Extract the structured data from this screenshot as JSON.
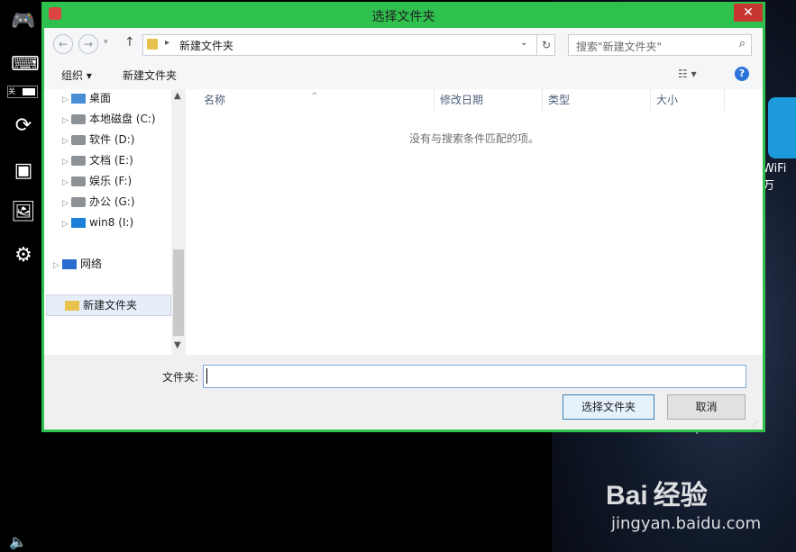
{
  "sidebar": {
    "icons": [
      "gamepad-icon",
      "keyboard-icon",
      "toggle-switch",
      "rotate-icon",
      "screenshot-icon",
      "gallery-icon",
      "settings-icon"
    ],
    "toggle_label": "关"
  },
  "dialog": {
    "title": "选择文件夹",
    "close_glyph": "✕",
    "address": {
      "path": "新建文件夹",
      "separator": "▸"
    },
    "search_placeholder": "搜索\"新建文件夹\"",
    "toolbar": {
      "organize": "组织 ▾",
      "new_folder": "新建文件夹"
    },
    "nav": [
      {
        "label": "桌面",
        "icon": "desktop-icon"
      },
      {
        "label": "本地磁盘 (C:)",
        "icon": "drive-icon"
      },
      {
        "label": "软件 (D:)",
        "icon": "drive-icon"
      },
      {
        "label": "文档 (E:)",
        "icon": "drive-icon"
      },
      {
        "label": "娱乐 (F:)",
        "icon": "drive-icon"
      },
      {
        "label": "办公  (G:)",
        "icon": "drive-icon"
      },
      {
        "label": "win8 (I:)",
        "icon": "windows-icon"
      }
    ],
    "network": "网络",
    "selected_folder": "新建文件夹",
    "columns": [
      "名称",
      "修改日期",
      "类型",
      "大小"
    ],
    "empty_message": "没有与搜索条件匹配的项。",
    "folder_label": "文件夹:",
    "folder_value": "",
    "buttons": {
      "select": "选择文件夹",
      "cancel": "取消"
    }
  },
  "desktop": {
    "app_label": "WiFi万",
    "watermark": {
      "brand": "Bai 经验",
      "url": "jingyan.baidu.com"
    }
  }
}
